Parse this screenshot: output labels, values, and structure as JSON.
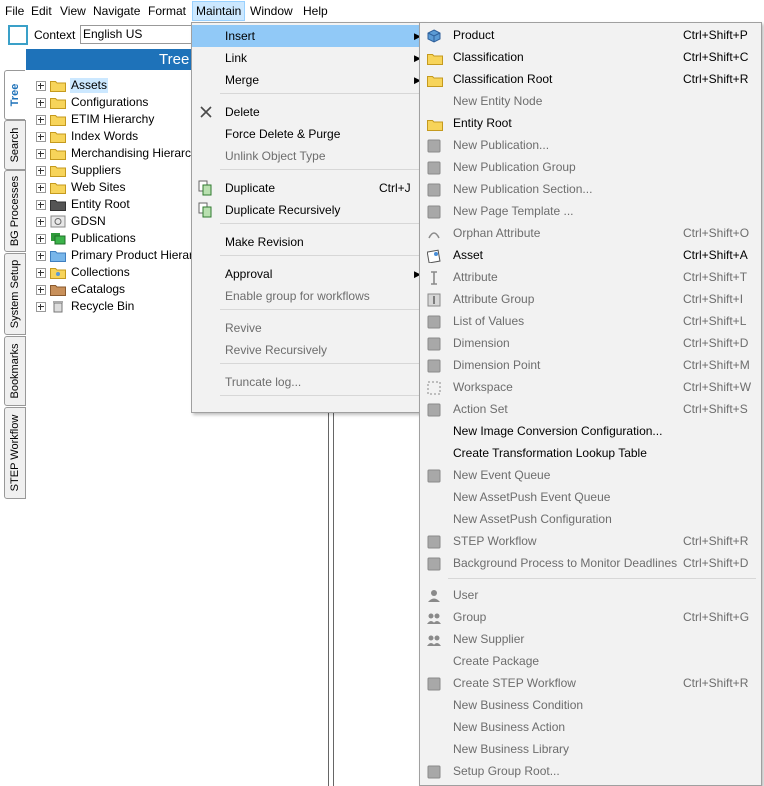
{
  "menubar": [
    "File",
    "Edit",
    "View",
    "Navigate",
    "Format",
    "Maintain",
    "Window",
    "Help"
  ],
  "context": {
    "label": "Context",
    "value": "English US"
  },
  "vertical_tabs": [
    "Tree",
    "Search",
    "BG Processes",
    "System Setup",
    "Bookmarks",
    "STEP Workflow"
  ],
  "tree": {
    "title": "Tree",
    "nodes": [
      {
        "label": "Assets",
        "icon": "folder-icon",
        "selected": true
      },
      {
        "label": "Configurations",
        "icon": "folder-icon"
      },
      {
        "label": "ETIM Hierarchy",
        "icon": "folder-icon"
      },
      {
        "label": "Index Words",
        "icon": "folder-icon"
      },
      {
        "label": "Merchandising Hierarchy",
        "icon": "folder-icon"
      },
      {
        "label": "Suppliers",
        "icon": "folder-icon"
      },
      {
        "label": "Web Sites",
        "icon": "folder-icon"
      },
      {
        "label": "Entity Root",
        "icon": "entity-root-icon"
      },
      {
        "label": "GDSN",
        "icon": "gdsn-icon"
      },
      {
        "label": "Publications",
        "icon": "publications-icon"
      },
      {
        "label": "Primary Product Hierarch",
        "icon": "product-folder-icon"
      },
      {
        "label": "Collections",
        "icon": "collections-icon"
      },
      {
        "label": "eCatalogs",
        "icon": "ecatalog-icon"
      },
      {
        "label": "Recycle Bin",
        "icon": "recycle-bin-icon"
      }
    ]
  },
  "maintain_menu": {
    "items": [
      {
        "label": "Insert",
        "submenu": true,
        "highlighted": true
      },
      {
        "label": "Link",
        "submenu": true
      },
      {
        "label": "Merge",
        "submenu": true
      },
      {
        "label": "Delete",
        "icon": "delete-x-icon"
      },
      {
        "label": "Force Delete & Purge"
      },
      {
        "label": "Unlink Object Type",
        "disabled": true
      },
      {
        "label": "Duplicate",
        "shortcut": "Ctrl+J",
        "icon": "duplicate-icon"
      },
      {
        "label": "Duplicate Recursively",
        "icon": "duplicate-recursive-icon"
      },
      {
        "label": "Make Revision"
      },
      {
        "label": "Approval",
        "submenu": true
      },
      {
        "label": "Enable group for workflows",
        "disabled": true
      },
      {
        "label": "Revive",
        "disabled": true
      },
      {
        "label": "Revive Recursively",
        "disabled": true
      },
      {
        "label": "Truncate log...",
        "disabled": true
      }
    ]
  },
  "insert_submenu": {
    "items": [
      {
        "label": "Product",
        "shortcut": "Ctrl+Shift+P",
        "icon": "product-cube-icon"
      },
      {
        "label": "Classification",
        "shortcut": "Ctrl+Shift+C",
        "icon": "folder-icon"
      },
      {
        "label": "Classification Root",
        "shortcut": "Ctrl+Shift+R",
        "icon": "folder-icon"
      },
      {
        "label": "New Entity Node",
        "disabled": true
      },
      {
        "label": "Entity Root",
        "icon": "folder-icon"
      },
      {
        "label": "New Publication...",
        "disabled": true,
        "icon": "publication-icon"
      },
      {
        "label": "New Publication Group",
        "disabled": true,
        "icon": "publication-group-icon"
      },
      {
        "label": "New Publication Section...",
        "disabled": true,
        "icon": "publication-section-icon"
      },
      {
        "label": "New Page Template ...",
        "disabled": true,
        "icon": "page-template-icon"
      },
      {
        "label": "Orphan Attribute",
        "shortcut": "Ctrl+Shift+O",
        "disabled": true,
        "icon": "orphan-attribute-icon"
      },
      {
        "label": "Asset",
        "shortcut": "Ctrl+Shift+A",
        "icon": "asset-icon"
      },
      {
        "label": "Attribute",
        "shortcut": "Ctrl+Shift+T",
        "disabled": true,
        "icon": "attribute-icon"
      },
      {
        "label": "Attribute Group",
        "shortcut": "Ctrl+Shift+I",
        "disabled": true,
        "icon": "attribute-group-icon"
      },
      {
        "label": "List of Values",
        "shortcut": "Ctrl+Shift+L",
        "disabled": true,
        "icon": "list-of-values-icon"
      },
      {
        "label": "Dimension",
        "shortcut": "Ctrl+Shift+D",
        "disabled": true,
        "icon": "dimension-icon"
      },
      {
        "label": "Dimension Point",
        "shortcut": "Ctrl+Shift+M",
        "disabled": true,
        "icon": "dimension-point-icon"
      },
      {
        "label": "Workspace",
        "shortcut": "Ctrl+Shift+W",
        "disabled": true,
        "icon": "workspace-icon"
      },
      {
        "label": "Action Set",
        "shortcut": "Ctrl+Shift+S",
        "disabled": true,
        "icon": "action-set-icon"
      },
      {
        "label": "New Image Conversion Configuration..."
      },
      {
        "label": "Create Transformation Lookup Table"
      },
      {
        "label": "New Event Queue",
        "disabled": true,
        "icon": "event-queue-icon"
      },
      {
        "label": "New AssetPush Event Queue",
        "disabled": true
      },
      {
        "label": "New AssetPush Configuration",
        "disabled": true
      },
      {
        "label": "STEP Workflow",
        "shortcut": "Ctrl+Shift+R",
        "disabled": true,
        "icon": "workflow-icon"
      },
      {
        "label": "Background Process to Monitor Deadlines",
        "shortcut": "Ctrl+Shift+D",
        "disabled": true,
        "icon": "background-process-icon"
      },
      {
        "label": "User",
        "disabled": true,
        "icon": "user-icon"
      },
      {
        "label": "Group",
        "shortcut": "Ctrl+Shift+G",
        "disabled": true,
        "icon": "group-icon"
      },
      {
        "label": "New Supplier",
        "disabled": true,
        "icon": "supplier-icon"
      },
      {
        "label": "Create Package",
        "disabled": true
      },
      {
        "label": "Create STEP Workflow",
        "shortcut": "Ctrl+Shift+R",
        "disabled": true,
        "icon": "workflow-icon"
      },
      {
        "label": "New Business Condition",
        "disabled": true
      },
      {
        "label": "New Business Action",
        "disabled": true
      },
      {
        "label": "New Business Library",
        "disabled": true
      },
      {
        "label": "Setup Group Root...",
        "disabled": true,
        "icon": "setup-group-icon"
      }
    ]
  },
  "colors": {
    "accent": "#1e72b9",
    "highlight": "#91c9f7",
    "disabled_text": "#6d6d6d"
  }
}
